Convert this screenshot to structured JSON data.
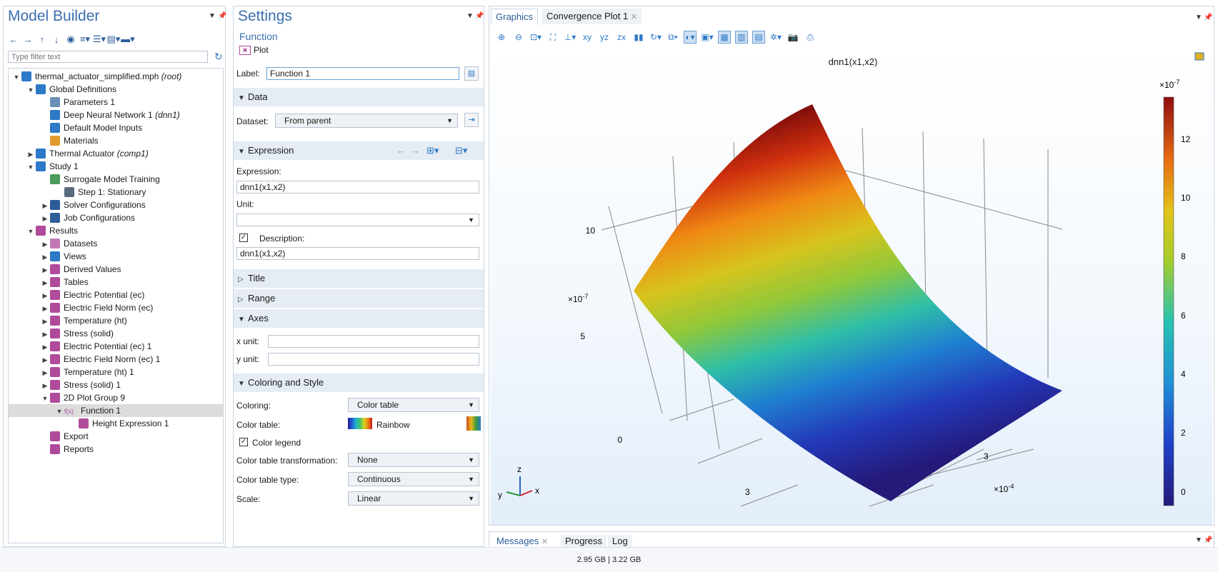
{
  "model_builder": {
    "title": "Model Builder",
    "filter_placeholder": "Type filter text",
    "tree": [
      {
        "label": "thermal_actuator_simplified.mph",
        "suffix": "(root)",
        "arrow": "▼",
        "icon": "model-icon",
        "color": "#2c79c7"
      },
      {
        "label": "Global Definitions",
        "suffix": "",
        "arrow": "▼",
        "icon": "globe-icon",
        "color": "#2c79c7"
      },
      {
        "label": "Parameters 1",
        "suffix": "",
        "arrow": "",
        "icon": "parameters-icon",
        "color": "#6a8fb8"
      },
      {
        "label": "Deep Neural Network 1",
        "suffix": "(dnn1)",
        "arrow": "",
        "icon": "neural-network-icon",
        "color": "#2c79c7"
      },
      {
        "label": "Default Model Inputs",
        "suffix": "",
        "arrow": "",
        "icon": "model-inputs-icon",
        "color": "#2c79c7"
      },
      {
        "label": "Materials",
        "suffix": "",
        "arrow": "",
        "icon": "materials-icon",
        "color": "#e39b2e"
      },
      {
        "label": "Thermal Actuator",
        "suffix": "(comp1)",
        "arrow": "▶",
        "icon": "component-icon",
        "color": "#2c79c7"
      },
      {
        "label": "Study 1",
        "suffix": "",
        "arrow": "▼",
        "icon": "study-icon",
        "color": "#2c79c7"
      },
      {
        "label": "Surrogate Model Training",
        "suffix": "",
        "arrow": "",
        "icon": "surrogate-training-icon",
        "color": "#4b9b5c"
      },
      {
        "label": "Step 1: Stationary",
        "suffix": "",
        "arrow": "",
        "icon": "stationary-step-icon",
        "color": "#5a6b7c"
      },
      {
        "label": "Solver Configurations",
        "suffix": "",
        "arrow": "▶",
        "icon": "solver-icon",
        "color": "#2c5d9a"
      },
      {
        "label": "Job Configurations",
        "suffix": "",
        "arrow": "▶",
        "icon": "job-icon",
        "color": "#2c5d9a"
      },
      {
        "label": "Results",
        "suffix": "",
        "arrow": "▼",
        "icon": "results-icon",
        "color": "#b04a9a"
      },
      {
        "label": "Datasets",
        "suffix": "",
        "arrow": "▶",
        "icon": "datasets-icon",
        "color": "#c17ab5"
      },
      {
        "label": "Views",
        "suffix": "",
        "arrow": "▶",
        "icon": "views-icon",
        "color": "#2c79c7"
      },
      {
        "label": "Derived Values",
        "suffix": "",
        "arrow": "▶",
        "icon": "derived-values-icon",
        "color": "#b04a9a"
      },
      {
        "label": "Tables",
        "suffix": "",
        "arrow": "▶",
        "icon": "tables-icon",
        "color": "#b04a9a"
      },
      {
        "label": "Electric Potential (ec)",
        "suffix": "",
        "arrow": "▶",
        "icon": "plot-group-3d-icon",
        "color": "#b04a9a"
      },
      {
        "label": "Electric Field Norm (ec)",
        "suffix": "",
        "arrow": "▶",
        "icon": "plot-group-3d-icon",
        "color": "#b04a9a"
      },
      {
        "label": "Temperature (ht)",
        "suffix": "",
        "arrow": "▶",
        "icon": "plot-group-3d-icon",
        "color": "#b04a9a"
      },
      {
        "label": "Stress (solid)",
        "suffix": "",
        "arrow": "▶",
        "icon": "plot-group-3d-icon",
        "color": "#b04a9a"
      },
      {
        "label": "Electric Potential (ec) 1",
        "suffix": "",
        "arrow": "▶",
        "icon": "plot-group-3d-icon",
        "color": "#b04a9a"
      },
      {
        "label": "Electric Field Norm (ec) 1",
        "suffix": "",
        "arrow": "▶",
        "icon": "plot-group-3d-icon",
        "color": "#b04a9a"
      },
      {
        "label": "Temperature (ht) 1",
        "suffix": "",
        "arrow": "▶",
        "icon": "plot-group-3d-icon",
        "color": "#b04a9a"
      },
      {
        "label": "Stress (solid) 1",
        "suffix": "",
        "arrow": "▶",
        "icon": "plot-group-3d-icon",
        "color": "#b04a9a"
      },
      {
        "label": "2D Plot Group 9",
        "suffix": "",
        "arrow": "▼",
        "icon": "plot-group-2d-icon",
        "color": "#b04a9a"
      },
      {
        "label": "Function 1",
        "suffix": "",
        "arrow": "▼",
        "icon": "function-icon",
        "color": "#b04a9a",
        "glyph": "f(x)"
      },
      {
        "label": "Height Expression 1",
        "suffix": "",
        "arrow": "",
        "icon": "height-expression-icon",
        "color": "#b04a9a"
      },
      {
        "label": "Export",
        "suffix": "",
        "arrow": "",
        "icon": "export-icon",
        "color": "#b04a9a"
      },
      {
        "label": "Reports",
        "suffix": "",
        "arrow": "",
        "icon": "reports-icon",
        "color": "#b04a9a"
      }
    ]
  },
  "settings": {
    "title": "Settings",
    "subtitle": "Function",
    "plot_button": "Plot",
    "label_caption": "Label:",
    "label_value": "Function 1",
    "sections": {
      "data": "Data",
      "expression": "Expression",
      "title": "Title",
      "range": "Range",
      "axes": "Axes",
      "coloring": "Coloring and Style"
    },
    "dataset_caption": "Dataset:",
    "dataset_value": "From parent",
    "expression_caption": "Expression:",
    "expression_value": "dnn1(x1,x2)",
    "unit_caption": "Unit:",
    "unit_value": "",
    "description_caption": "Description:",
    "description_value": "dnn1(x1,x2)",
    "x_unit_caption": "x unit:",
    "y_unit_caption": "y unit:",
    "coloring_caption": "Coloring:",
    "coloring_value": "Color table",
    "color_table_caption": "Color table:",
    "color_table_value": "Rainbow",
    "color_legend_caption": "Color legend",
    "transformation_caption": "Color table transformation:",
    "transformation_value": "None",
    "table_type_caption": "Color table type:",
    "table_type_value": "Continuous",
    "scale_caption": "Scale:",
    "scale_value": "Linear"
  },
  "graphics": {
    "tab_graphics": "Graphics",
    "tab_convergence": "Convergence Plot 1",
    "plot_title": "dnn1(x1,x2)",
    "z_multiplier": "×10",
    "z_exponent": "-7",
    "z_ticks": [
      "10",
      "5",
      "0"
    ],
    "x_multiplier": "×10",
    "x_exponent": "-4",
    "x_tick": "3",
    "y_tick": "3",
    "legend_multiplier": "×10",
    "legend_exponent": "-7",
    "legend_ticks": [
      "12",
      "10",
      "8",
      "6",
      "4",
      "2",
      "0"
    ],
    "triad": {
      "z": "z",
      "y": "y",
      "x": "x"
    }
  },
  "messages": {
    "tab_messages": "Messages",
    "tab_progress": "Progress",
    "tab_log": "Log"
  },
  "status": {
    "memory": "2.95 GB | 3.22 GB"
  }
}
